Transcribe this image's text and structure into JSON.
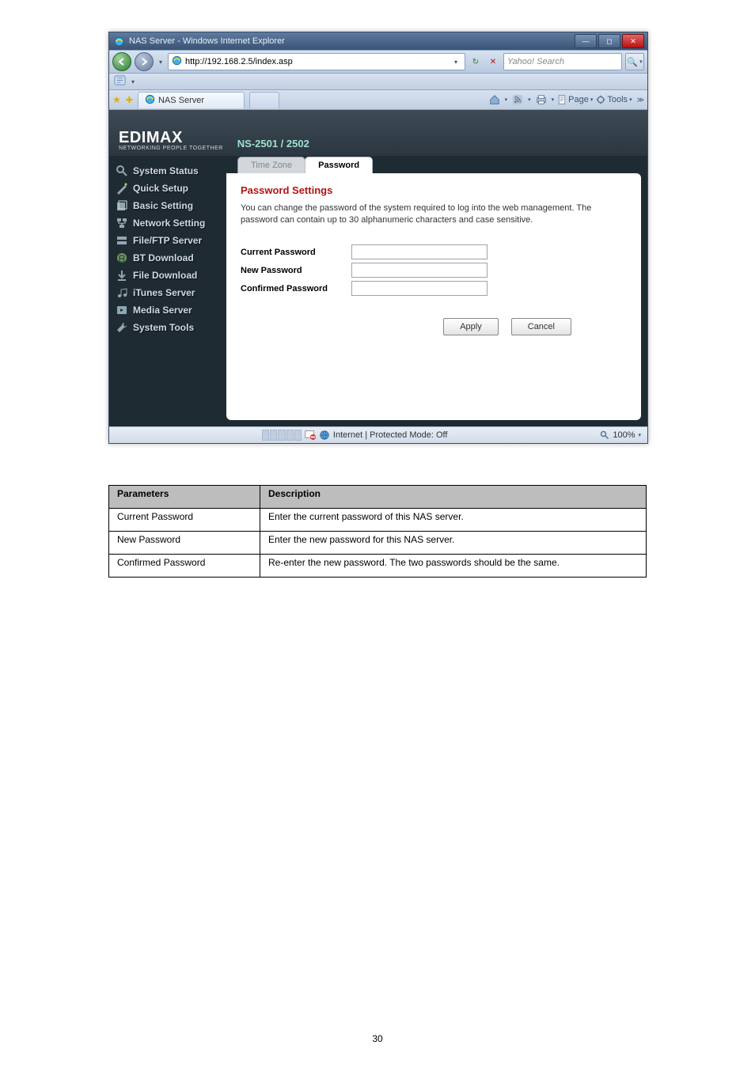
{
  "page_label": "30",
  "window": {
    "title": "NAS Server - Windows Internet Explorer",
    "url": "http://192.168.2.5/index.asp",
    "search_placeholder": "Yahoo! Search",
    "tab_label": "NAS Server",
    "toolbar": {
      "page_label": "Page",
      "tools_label": "Tools"
    },
    "status": {
      "zone": "Internet | Protected Mode: Off",
      "zoom": "100%"
    }
  },
  "brand": {
    "main": "EDIMAX",
    "sub": "NETWORKING PEOPLE TOGETHER",
    "model": "NS-2501 / 2502"
  },
  "sidebar": {
    "items": [
      {
        "label": "System Status"
      },
      {
        "label": "Quick Setup"
      },
      {
        "label": "Basic Setting"
      },
      {
        "label": "Network Setting"
      },
      {
        "label": "File/FTP Server"
      },
      {
        "label": "BT Download"
      },
      {
        "label": "File Download"
      },
      {
        "label": "iTunes Server"
      },
      {
        "label": "Media Server"
      },
      {
        "label": "System Tools"
      }
    ]
  },
  "app_tabs": {
    "inactive": "Time Zone",
    "active": "Password"
  },
  "panel": {
    "title": "Password Settings",
    "description": "You can change the password of the system required to log into the web management. The password can contain up to 30 alphanumeric characters and case sensitive.",
    "fields": {
      "current": "Current Password",
      "new": "New Password",
      "confirm": "Confirmed Password"
    },
    "buttons": {
      "apply": "Apply",
      "cancel": "Cancel"
    }
  },
  "param_table": {
    "head_param": "Parameters",
    "head_desc": "Description",
    "rows": [
      {
        "param": "Current Password",
        "desc": "Enter the current password of this NAS server."
      },
      {
        "param": "New Password",
        "desc": "Enter the new password for this NAS server."
      },
      {
        "param": "Confirmed Password",
        "desc": "Re-enter the new password. The two passwords should be the same."
      }
    ]
  }
}
